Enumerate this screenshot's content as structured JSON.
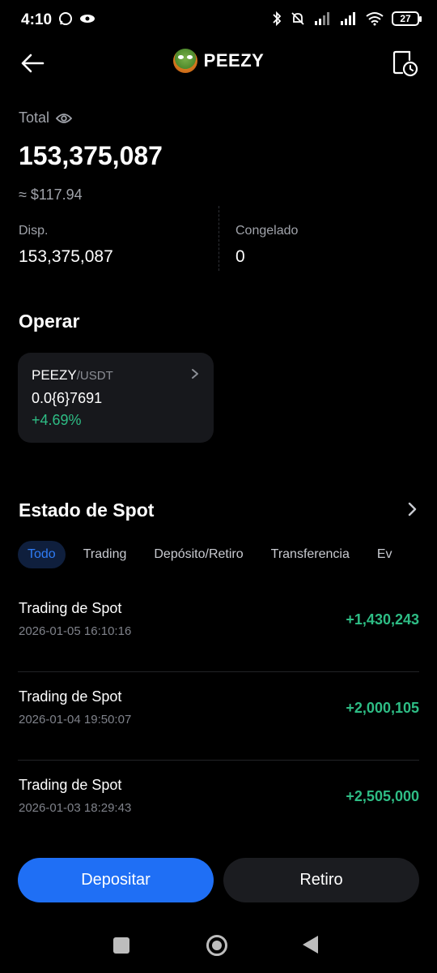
{
  "status_bar": {
    "time": "4:10",
    "battery": "27"
  },
  "header": {
    "coin_name": "PEEZY",
    "back_icon": "arrow-left-icon",
    "history_icon": "document-clock-icon"
  },
  "balance": {
    "total_label": "Total",
    "total_value": "153,375,087",
    "total_usd": "≈ $117.94",
    "available_label": "Disp.",
    "available_value": "153,375,087",
    "frozen_label": "Congelado",
    "frozen_value": "0"
  },
  "trade": {
    "section_title": "Operar",
    "pair_base": "PEEZY",
    "pair_quote": "/USDT",
    "price": "0.0{6}7691",
    "change": "+4.69%"
  },
  "spot_status": {
    "section_title": "Estado de Spot",
    "tabs": [
      "Todo",
      "Trading",
      "Depósito/Retiro",
      "Transferencia",
      "Ev"
    ],
    "transactions": [
      {
        "title": "Trading de Spot",
        "date": "2026-01-05 16:10:16",
        "amount": "+1,430,243"
      },
      {
        "title": "Trading de Spot",
        "date": "2026-01-04 19:50:07",
        "amount": "+2,000,105"
      },
      {
        "title": "Trading de Spot",
        "date": "2026-01-03 18:29:43",
        "amount": "+2,505,000"
      }
    ]
  },
  "actions": {
    "deposit_label": "Depositar",
    "withdraw_label": "Retiro"
  },
  "colors": {
    "positive": "#2ebd85",
    "accent": "#1f6ff5",
    "background": "#000000"
  }
}
